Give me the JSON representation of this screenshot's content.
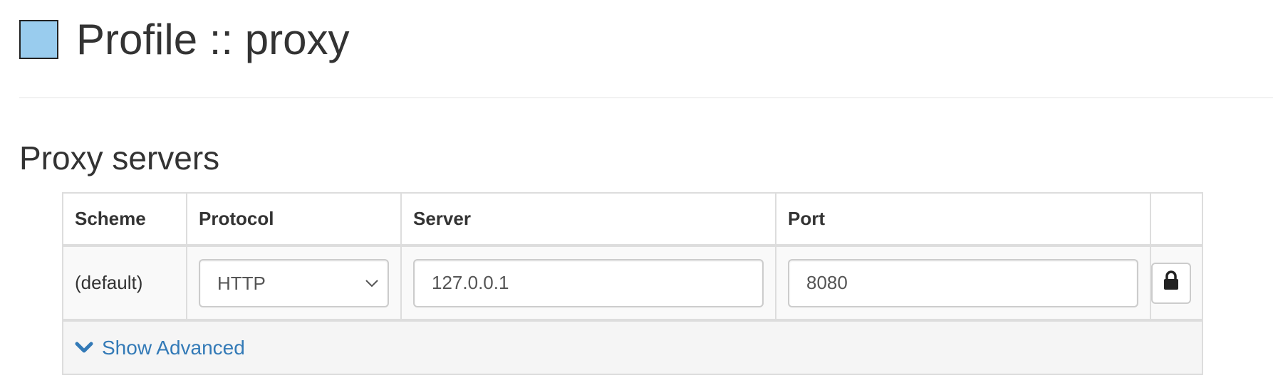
{
  "header": {
    "profile_color": "#99ccee",
    "title": "Profile :: proxy"
  },
  "section": {
    "title": "Proxy servers"
  },
  "table": {
    "columns": [
      "Scheme",
      "Protocol",
      "Server",
      "Port",
      ""
    ],
    "rows": [
      {
        "scheme": "(default)",
        "protocol": "HTTP",
        "server": "127.0.0.1",
        "port": "8080",
        "action_icon": "lock-icon"
      }
    ]
  },
  "advanced": {
    "label": "Show Advanced",
    "icon": "chevron-down-icon",
    "color": "#337ab7"
  }
}
